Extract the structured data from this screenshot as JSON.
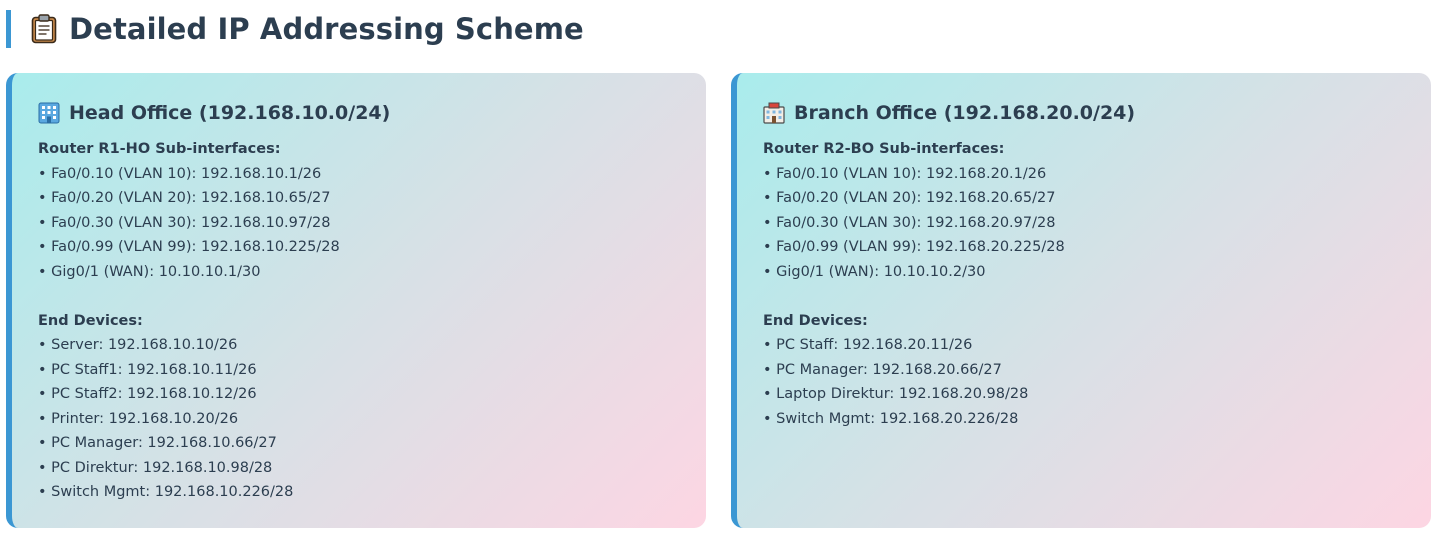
{
  "header": {
    "title": "Detailed IP Addressing Scheme",
    "icon": "clipboard-icon"
  },
  "offices": [
    {
      "icon": "office-building-icon",
      "title": "Head Office (192.168.10.0/24)",
      "router_label": "Router R1-HO Sub-interfaces:",
      "interfaces": [
        "• Fa0/0.10 (VLAN 10): 192.168.10.1/26",
        "• Fa0/0.20 (VLAN 20): 192.168.10.65/27",
        "• Fa0/0.30 (VLAN 30): 192.168.10.97/28",
        "• Fa0/0.99 (VLAN 99): 192.168.10.225/28",
        "• Gig0/1 (WAN): 10.10.10.1/30"
      ],
      "devices_label": "End Devices:",
      "devices": [
        "• Server: 192.168.10.10/26",
        "• PC Staff1: 192.168.10.11/26",
        "• PC Staff2: 192.168.10.12/26",
        "• Printer: 192.168.10.20/26",
        "• PC Manager: 192.168.10.66/27",
        "• PC Direktur: 192.168.10.98/28",
        "• Switch Mgmt: 192.168.10.226/28"
      ]
    },
    {
      "icon": "branch-building-icon",
      "title": "Branch Office (192.168.20.0/24)",
      "router_label": "Router R2-BO Sub-interfaces:",
      "interfaces": [
        "• Fa0/0.10 (VLAN 10): 192.168.20.1/26",
        "• Fa0/0.20 (VLAN 20): 192.168.20.65/27",
        "• Fa0/0.30 (VLAN 30): 192.168.20.97/28",
        "• Fa0/0.99 (VLAN 99): 192.168.20.225/28",
        "• Gig0/1 (WAN): 10.10.10.2/30"
      ],
      "devices_label": "End Devices:",
      "devices": [
        "• PC Staff: 192.168.20.11/26",
        "• PC Manager: 192.168.20.66/27",
        "• Laptop Direktur: 192.168.20.98/28",
        "• Switch Mgmt: 192.168.20.226/28"
      ]
    }
  ],
  "colors": {
    "accent": "#3b97d3",
    "text": "#2c3e50",
    "gradient_start": "#a9ecec",
    "gradient_end": "#fdd6e3"
  }
}
